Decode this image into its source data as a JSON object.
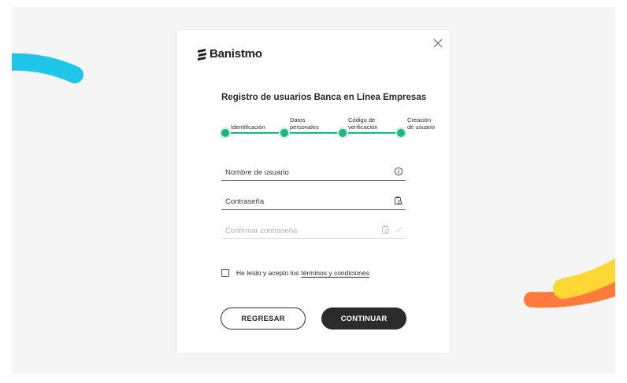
{
  "brand": {
    "name": "Banistmo"
  },
  "form": {
    "title": "Registro de usuarios Banca en Línea Empresas",
    "steps": [
      {
        "label_line1": "Identificación",
        "label_line2": ""
      },
      {
        "label_line1": "Datos",
        "label_line2": "personales"
      },
      {
        "label_line1": "Código de",
        "label_line2": "verificación"
      },
      {
        "label_line1": "Creación",
        "label_line2": "de usuario"
      }
    ],
    "fields": {
      "username": {
        "placeholder": "Nombre de usuario",
        "icon": "info-icon",
        "enabled": true
      },
      "password": {
        "placeholder": "Contraseña",
        "icon": "show-password-icon",
        "enabled": true
      },
      "confirm_password": {
        "placeholder": "Confirmar contraseña",
        "icon": "show-password-icon",
        "enabled": false
      }
    },
    "terms": {
      "text": "He leído y acepto los",
      "link": "términos y condiciones",
      "checked": false
    },
    "buttons": {
      "back": "REGRESAR",
      "continue": "CONTINUAR"
    }
  },
  "colors": {
    "accent_green": "#1db584",
    "dark": "#2b2b2b",
    "deco_cyan": "#1fc6e8",
    "deco_yellow": "#fdd835",
    "deco_orange": "#ff7a3d"
  }
}
